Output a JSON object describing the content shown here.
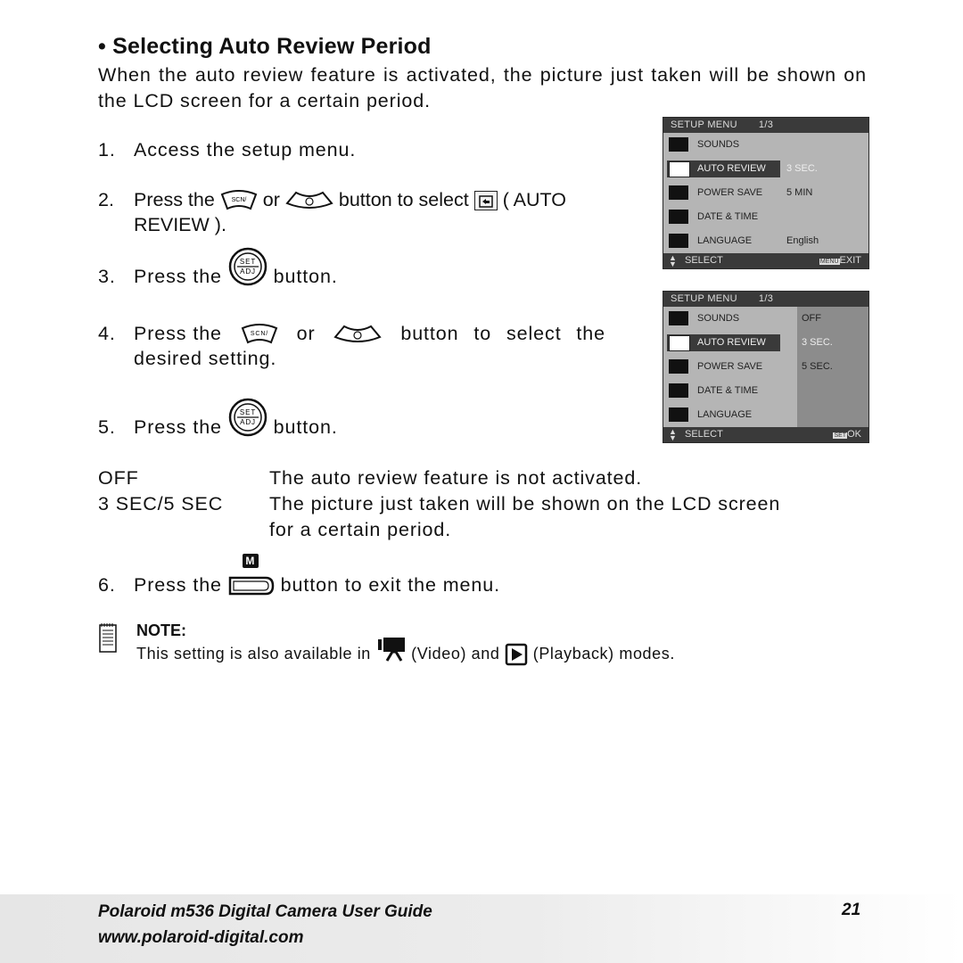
{
  "title": "• Selecting Auto Review Period",
  "intro": "When the auto review feature is activated, the picture just taken will be shown on the LCD screen for a certain period.",
  "steps": [
    {
      "num": "1.",
      "parts": [
        "Access the setup menu."
      ]
    },
    {
      "num": "2.",
      "parts": [
        "Press the",
        "or",
        "button to select",
        "( AUTO",
        "REVIEW )."
      ]
    },
    {
      "num": "3.",
      "parts": [
        "Press the",
        "button."
      ]
    },
    {
      "num": "4.",
      "parts": [
        "Press the",
        "or",
        "button to select the",
        "desired setting."
      ]
    },
    {
      "num": "5.",
      "parts": [
        "Press the",
        "button."
      ]
    },
    {
      "num": "6.",
      "parts": [
        "Press the",
        "button to exit the menu."
      ]
    }
  ],
  "icons": {
    "scn_button": "SCN/",
    "set_adj_top": "SET",
    "set_adj_bottom": "ADJ",
    "menu_key": "M"
  },
  "definitions": [
    {
      "term": "OFF",
      "desc": "The auto review feature is not activated."
    },
    {
      "term": "3 SEC/5 SEC",
      "desc": "The picture just taken will be shown on the LCD screen",
      "desc2": "for a certain period."
    }
  ],
  "menu1": {
    "header": "SETUP MENU",
    "page": "1/3",
    "rows": [
      {
        "label": "SOUNDS",
        "value": ""
      },
      {
        "label": "AUTO REVIEW",
        "value": "3 SEC."
      },
      {
        "label": "POWER SAVE",
        "value": "5 MIN"
      },
      {
        "label": "DATE & TIME",
        "value": ""
      },
      {
        "label": "LANGUAGE",
        "value": "English"
      }
    ],
    "footer_left": "SELECT",
    "footer_key": "MENU",
    "footer_right": "EXIT"
  },
  "menu2": {
    "header": "SETUP MENU",
    "page": "1/3",
    "rows": [
      {
        "label": "SOUNDS"
      },
      {
        "label": "AUTO REVIEW"
      },
      {
        "label": "POWER SAVE"
      },
      {
        "label": "DATE & TIME"
      },
      {
        "label": "LANGUAGE"
      }
    ],
    "options": [
      "OFF",
      "3 SEC.",
      "5 SEC."
    ],
    "footer_left": "SELECT",
    "footer_key": "SET",
    "footer_right": "OK"
  },
  "note": {
    "heading": "NOTE:",
    "text_a": "This setting is also available in",
    "text_b": "(Video) and",
    "text_c": "(Playback) modes."
  },
  "footer": {
    "line1": "Polaroid m536 Digital Camera User Guide",
    "line2": "www.polaroid-digital.com",
    "page_number": "21"
  }
}
